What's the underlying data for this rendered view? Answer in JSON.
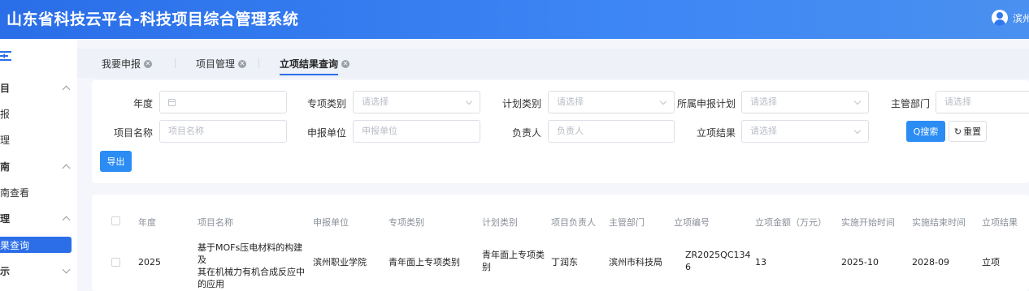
{
  "header": {
    "title": "山东省科技云平台-科技项目综合管理系统",
    "user_name": "滨州"
  },
  "sidebar": {
    "items": [
      {
        "label": "目",
        "type": "group",
        "chevron": "up"
      },
      {
        "label": "报",
        "type": "item"
      },
      {
        "label": "理",
        "type": "item"
      },
      {
        "label": "南",
        "type": "group",
        "chevron": "up"
      },
      {
        "label": "南查看",
        "type": "item"
      },
      {
        "label": "理",
        "type": "group",
        "chevron": "up"
      },
      {
        "label": "果查询",
        "type": "active"
      },
      {
        "label": "示",
        "type": "group",
        "chevron": "down"
      }
    ]
  },
  "tabs": [
    {
      "label": "我要申报"
    },
    {
      "label": "项目管理"
    },
    {
      "label": "立项结果查询",
      "active": true
    }
  ],
  "filters": {
    "year": {
      "label": "年度"
    },
    "special_category": {
      "label": "专项类别",
      "placeholder": "请选择"
    },
    "plan_category": {
      "label": "计划类别",
      "placeholder": "请选择"
    },
    "application_plan": {
      "label": "所属申报计划",
      "placeholder": "请选择"
    },
    "department": {
      "label": "主管部门",
      "placeholder": "请选择"
    },
    "project_name": {
      "label": "项目名称",
      "placeholder": "项目名称"
    },
    "applicant_unit": {
      "label": "申报单位",
      "placeholder": "申报单位"
    },
    "leader": {
      "label": "负责人",
      "placeholder": "负责人"
    },
    "result": {
      "label": "立项结果",
      "placeholder": "请选择"
    },
    "search_button": "Q搜索",
    "reset_button": "重置",
    "export_button": "导出"
  },
  "table": {
    "columns": [
      "年度",
      "项目名称",
      "申报单位",
      "专项类别",
      "计划类别",
      "项目负责人",
      "主管部门",
      "立项编号",
      "立项金额（万元）",
      "实施开始时间",
      "实施结束时间",
      "立项结果"
    ],
    "rows": [
      {
        "year": "2025",
        "name_lines": [
          "基于MOFs压电材料的构建及",
          "其在机械力有机合成反应中",
          "的应用"
        ],
        "unit": "滨州职业学院",
        "special": "青年面上专项类别",
        "plan_lines": [
          "青年面上专项类",
          "别"
        ],
        "leader": "丁润东",
        "dept": "滨州市科技局",
        "code_lines": [
          "ZR2025QC134",
          "6"
        ],
        "amount": "13",
        "start": "2025-10",
        "end": "2028-09",
        "result": "立项"
      }
    ]
  },
  "colors": {
    "primary": "#2b6ee8",
    "button": "#2b8cf3",
    "header": "#3d86f5"
  }
}
